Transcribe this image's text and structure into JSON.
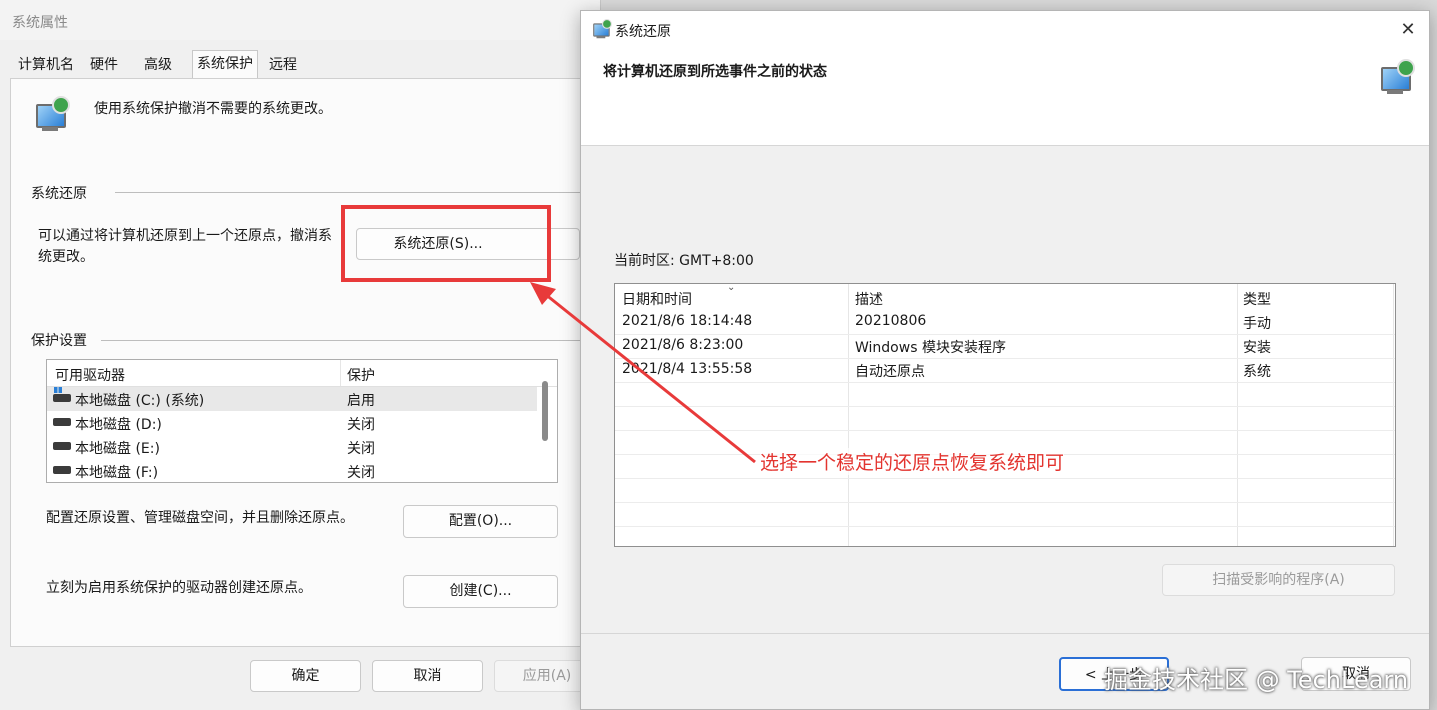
{
  "left_window": {
    "title": "系统属性",
    "tabs": [
      "计算机名",
      "硬件",
      "高级",
      "系统保护",
      "远程"
    ],
    "active_tab": "系统保护",
    "description": "使用系统保护撤消不需要的系统更改。",
    "system_restore": {
      "group_label": "系统还原",
      "text_line1": "可以通过将计算机还原到上一个还原点，撤消系",
      "text_line2": "统更改。",
      "button_label": "系统还原(S)..."
    },
    "protection": {
      "group_label": "保护设置",
      "columns": [
        "可用驱动器",
        "保护"
      ],
      "drives": [
        {
          "name": "本地磁盘 (C:) (系统)",
          "status": "启用",
          "selected": true
        },
        {
          "name": "本地磁盘 (D:)",
          "status": "关闭",
          "selected": false
        },
        {
          "name": "本地磁盘 (E:)",
          "status": "关闭",
          "selected": false
        },
        {
          "name": "本地磁盘 (F:)",
          "status": "关闭",
          "selected": false
        }
      ],
      "configure_text": "配置还原设置、管理磁盘空间，并且删除还原点。",
      "configure_button": "配置(O)...",
      "create_text": "立刻为启用系统保护的驱动器创建还原点。",
      "create_button": "创建(C)..."
    },
    "footer": {
      "ok": "确定",
      "cancel": "取消",
      "apply": "应用(A)"
    }
  },
  "right_window": {
    "title": "系统还原",
    "heading": "将计算机还原到所选事件之前的状态",
    "timezone": "当前时区: GMT+8:00",
    "columns": [
      "日期和时间",
      "描述",
      "类型"
    ],
    "restore_points": [
      {
        "datetime": "2021/8/6 18:14:48",
        "description": "20210806",
        "type": "手动"
      },
      {
        "datetime": "2021/8/6 8:23:00",
        "description": "Windows 模块安装程序",
        "type": "安装"
      },
      {
        "datetime": "2021/8/4 13:55:58",
        "description": "自动还原点",
        "type": "系统"
      }
    ],
    "scan_button": "扫描受影响的程序(A)",
    "back_button": "< 上一步",
    "cancel_button": "取消",
    "close_glyph": "✕"
  },
  "annotation": {
    "text": "选择一个稳定的还原点恢复系统即可",
    "color": "#e3342f"
  },
  "watermark": "掘金技术社区 @ TechLearn"
}
